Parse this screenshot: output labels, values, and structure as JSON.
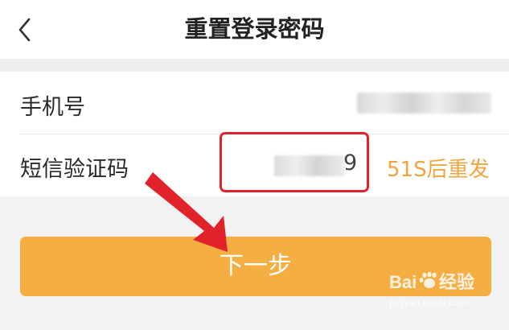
{
  "header": {
    "title": "重置登录密码",
    "back_icon": "chevron-left-icon"
  },
  "form": {
    "phone_label": "手机号",
    "code_label": "短信验证码",
    "code_visible_tail": "9",
    "resend_label": "51S后重发"
  },
  "actions": {
    "next_label": "下一步"
  },
  "watermark": {
    "brand_prefix": "Bai",
    "brand_suffix": "经验",
    "url": "jingyan.baidu.com"
  },
  "colors": {
    "accent": "#f5ae41",
    "resend_text": "#f3a53d",
    "annotation_red": "#e2222b",
    "background": "#f2f2f2"
  }
}
